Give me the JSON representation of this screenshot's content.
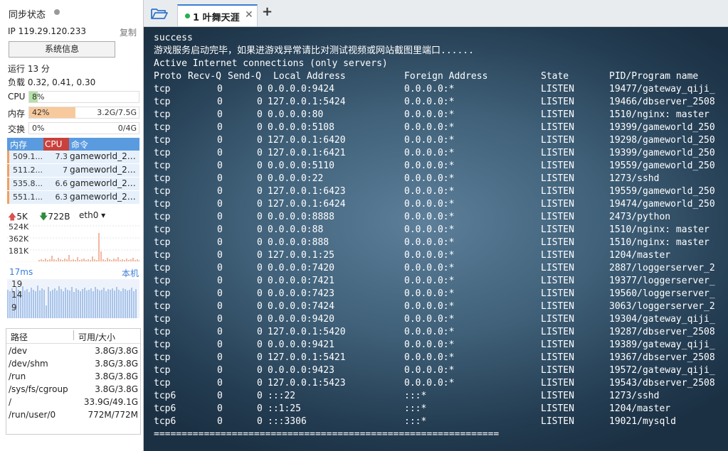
{
  "sidebar": {
    "sync_title": "同步状态",
    "ip": "IP 119.29.120.233",
    "copy_label": "复制",
    "sysinfo_button": "系统信息",
    "uptime": "运行 13 分",
    "load": "负载 0.32, 0.41, 0.30",
    "meters": {
      "cpu": {
        "label": "CPU",
        "pct": "8%",
        "value": "",
        "fraction": 0.08,
        "color": "#b6e0a8"
      },
      "mem": {
        "label": "内存",
        "pct": "42%",
        "value": "3.2G/7.5G",
        "fraction": 0.42,
        "color": "#f7c99c"
      },
      "swap": {
        "label": "交换",
        "pct": "0%",
        "value": "0/4G",
        "fraction": 0.0,
        "color": "#cccccc"
      }
    },
    "proc_headers": {
      "mem": "内存",
      "cpu": "CPU",
      "cmd": "命令"
    },
    "processes": [
      {
        "mem": "509.1...",
        "cpu": "7.3",
        "cmd": "gameworld_25..."
      },
      {
        "mem": "511.2...",
        "cpu": "7",
        "cmd": "gameworld_25..."
      },
      {
        "mem": "535.8...",
        "cpu": "6.6",
        "cmd": "gameworld_25..."
      },
      {
        "mem": "551.1...",
        "cpu": "6.3",
        "cmd": "gameworld_25..."
      }
    ],
    "network": {
      "up": "5K",
      "down": "722B",
      "interface": "eth0",
      "y_labels": [
        "524K",
        "362K",
        "181K"
      ]
    },
    "latency": {
      "ms": "17ms",
      "location": "本机",
      "y_labels": [
        "19",
        "14",
        "9"
      ]
    },
    "disk": {
      "headers": {
        "path": "路径",
        "size": "可用/大小"
      },
      "rows": [
        {
          "path": "/dev",
          "size": "3.8G/3.8G"
        },
        {
          "path": "/dev/shm",
          "size": "3.8G/3.8G"
        },
        {
          "path": "/run",
          "size": "3.8G/3.8G"
        },
        {
          "path": "/sys/fs/cgroup",
          "size": "3.8G/3.8G"
        },
        {
          "path": "/",
          "size": "33.9G/49.1G"
        },
        {
          "path": "/run/user/0",
          "size": "772M/772M"
        }
      ]
    }
  },
  "tabs": [
    {
      "label": "1 叶舞天涯",
      "active": true
    }
  ],
  "terminal": {
    "intro": [
      "success",
      "游戏服务启动完毕，如果进游戏异常请比对测试视频或网站截图里端口......",
      "Active Internet connections (only servers)"
    ],
    "headers": {
      "proto": "Proto",
      "recvq": "Recv-Q",
      "sendq": "Send-Q",
      "local": "Local Address",
      "foreign": "Foreign Address",
      "state": "State",
      "pid": "PID/Program name"
    },
    "rows": [
      {
        "proto": "tcp",
        "recvq": "0",
        "sendq": "0",
        "local": "0.0.0.0:9424",
        "foreign": "0.0.0.0:*",
        "state": "LISTEN",
        "pid": "19477/gateway_qiji_"
      },
      {
        "proto": "tcp",
        "recvq": "0",
        "sendq": "0",
        "local": "127.0.0.1:5424",
        "foreign": "0.0.0.0:*",
        "state": "LISTEN",
        "pid": "19466/dbserver_2508"
      },
      {
        "proto": "tcp",
        "recvq": "0",
        "sendq": "0",
        "local": "0.0.0.0:80",
        "foreign": "0.0.0.0:*",
        "state": "LISTEN",
        "pid": "1510/nginx: master"
      },
      {
        "proto": "tcp",
        "recvq": "0",
        "sendq": "0",
        "local": "0.0.0.0:5108",
        "foreign": "0.0.0.0:*",
        "state": "LISTEN",
        "pid": "19399/gameworld_250"
      },
      {
        "proto": "tcp",
        "recvq": "0",
        "sendq": "0",
        "local": "127.0.0.1:6420",
        "foreign": "0.0.0.0:*",
        "state": "LISTEN",
        "pid": "19298/gameworld_250"
      },
      {
        "proto": "tcp",
        "recvq": "0",
        "sendq": "0",
        "local": "127.0.0.1:6421",
        "foreign": "0.0.0.0:*",
        "state": "LISTEN",
        "pid": "19399/gameworld_250"
      },
      {
        "proto": "tcp",
        "recvq": "0",
        "sendq": "0",
        "local": "0.0.0.0:5110",
        "foreign": "0.0.0.0:*",
        "state": "LISTEN",
        "pid": "19559/gameworld_250"
      },
      {
        "proto": "tcp",
        "recvq": "0",
        "sendq": "0",
        "local": "0.0.0.0:22",
        "foreign": "0.0.0.0:*",
        "state": "LISTEN",
        "pid": "1273/sshd"
      },
      {
        "proto": "tcp",
        "recvq": "0",
        "sendq": "0",
        "local": "127.0.0.1:6423",
        "foreign": "0.0.0.0:*",
        "state": "LISTEN",
        "pid": "19559/gameworld_250"
      },
      {
        "proto": "tcp",
        "recvq": "0",
        "sendq": "0",
        "local": "127.0.0.1:6424",
        "foreign": "0.0.0.0:*",
        "state": "LISTEN",
        "pid": "19474/gameworld_250"
      },
      {
        "proto": "tcp",
        "recvq": "0",
        "sendq": "0",
        "local": "0.0.0.0:8888",
        "foreign": "0.0.0.0:*",
        "state": "LISTEN",
        "pid": "2473/python"
      },
      {
        "proto": "tcp",
        "recvq": "0",
        "sendq": "0",
        "local": "0.0.0.0:88",
        "foreign": "0.0.0.0:*",
        "state": "LISTEN",
        "pid": "1510/nginx: master"
      },
      {
        "proto": "tcp",
        "recvq": "0",
        "sendq": "0",
        "local": "0.0.0.0:888",
        "foreign": "0.0.0.0:*",
        "state": "LISTEN",
        "pid": "1510/nginx: master"
      },
      {
        "proto": "tcp",
        "recvq": "0",
        "sendq": "0",
        "local": "127.0.0.1:25",
        "foreign": "0.0.0.0:*",
        "state": "LISTEN",
        "pid": "1204/master"
      },
      {
        "proto": "tcp",
        "recvq": "0",
        "sendq": "0",
        "local": "0.0.0.0:7420",
        "foreign": "0.0.0.0:*",
        "state": "LISTEN",
        "pid": "2887/loggerserver_2"
      },
      {
        "proto": "tcp",
        "recvq": "0",
        "sendq": "0",
        "local": "0.0.0.0:7421",
        "foreign": "0.0.0.0:*",
        "state": "LISTEN",
        "pid": "19377/loggerserver_"
      },
      {
        "proto": "tcp",
        "recvq": "0",
        "sendq": "0",
        "local": "0.0.0.0:7423",
        "foreign": "0.0.0.0:*",
        "state": "LISTEN",
        "pid": "19560/loggerserver_"
      },
      {
        "proto": "tcp",
        "recvq": "0",
        "sendq": "0",
        "local": "0.0.0.0:7424",
        "foreign": "0.0.0.0:*",
        "state": "LISTEN",
        "pid": "3063/loggerserver_2"
      },
      {
        "proto": "tcp",
        "recvq": "0",
        "sendq": "0",
        "local": "0.0.0.0:9420",
        "foreign": "0.0.0.0:*",
        "state": "LISTEN",
        "pid": "19304/gateway_qiji_"
      },
      {
        "proto": "tcp",
        "recvq": "0",
        "sendq": "0",
        "local": "127.0.0.1:5420",
        "foreign": "0.0.0.0:*",
        "state": "LISTEN",
        "pid": "19287/dbserver_2508"
      },
      {
        "proto": "tcp",
        "recvq": "0",
        "sendq": "0",
        "local": "0.0.0.0:9421",
        "foreign": "0.0.0.0:*",
        "state": "LISTEN",
        "pid": "19389/gateway_qiji_"
      },
      {
        "proto": "tcp",
        "recvq": "0",
        "sendq": "0",
        "local": "127.0.0.1:5421",
        "foreign": "0.0.0.0:*",
        "state": "LISTEN",
        "pid": "19367/dbserver_2508"
      },
      {
        "proto": "tcp",
        "recvq": "0",
        "sendq": "0",
        "local": "0.0.0.0:9423",
        "foreign": "0.0.0.0:*",
        "state": "LISTEN",
        "pid": "19572/gateway_qiji_"
      },
      {
        "proto": "tcp",
        "recvq": "0",
        "sendq": "0",
        "local": "127.0.0.1:5423",
        "foreign": "0.0.0.0:*",
        "state": "LISTEN",
        "pid": "19543/dbserver_2508"
      },
      {
        "proto": "tcp6",
        "recvq": "0",
        "sendq": "0",
        "local": ":::22",
        "foreign": ":::*",
        "state": "LISTEN",
        "pid": "1273/sshd"
      },
      {
        "proto": "tcp6",
        "recvq": "0",
        "sendq": "0",
        "local": "::1:25",
        "foreign": ":::*",
        "state": "LISTEN",
        "pid": "1204/master"
      },
      {
        "proto": "tcp6",
        "recvq": "0",
        "sendq": "0",
        "local": ":::3306",
        "foreign": ":::*",
        "state": "LISTEN",
        "pid": "19021/mysqld"
      }
    ],
    "separator": "=============================================================="
  },
  "colors": {
    "accent": "#3b7dd8",
    "proc_header": "#5a9be0",
    "proc_cpu_header": "#c8413d",
    "tab_status_dot": "#22b14c"
  }
}
